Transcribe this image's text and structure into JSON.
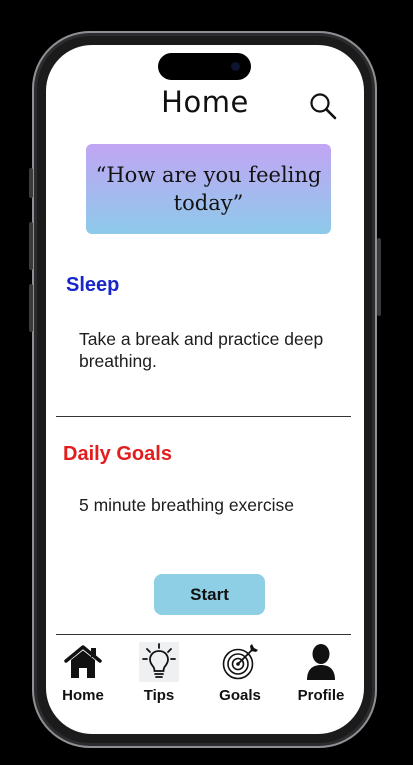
{
  "header": {
    "title": "Home",
    "search_icon": "search-icon"
  },
  "quote_card": {
    "text": "“How are you feeling today”",
    "gradient": [
      "#c2a5f4",
      "#8dcaea"
    ]
  },
  "sleep": {
    "title": "Sleep",
    "title_color": "#1626c8",
    "text": "Take a break and practice deep breathing."
  },
  "daily_goals": {
    "title": "Daily Goals",
    "title_color": "#e31d1d",
    "text": "5 minute breathing exercise",
    "button_label": "Start",
    "button_color": "#8ecfe6"
  },
  "nav": {
    "items": [
      {
        "label": "Home",
        "icon": "home-icon"
      },
      {
        "label": "Tips",
        "icon": "lightbulb-icon"
      },
      {
        "label": "Goals",
        "icon": "target-icon"
      },
      {
        "label": "Profile",
        "icon": "user-icon"
      }
    ]
  }
}
